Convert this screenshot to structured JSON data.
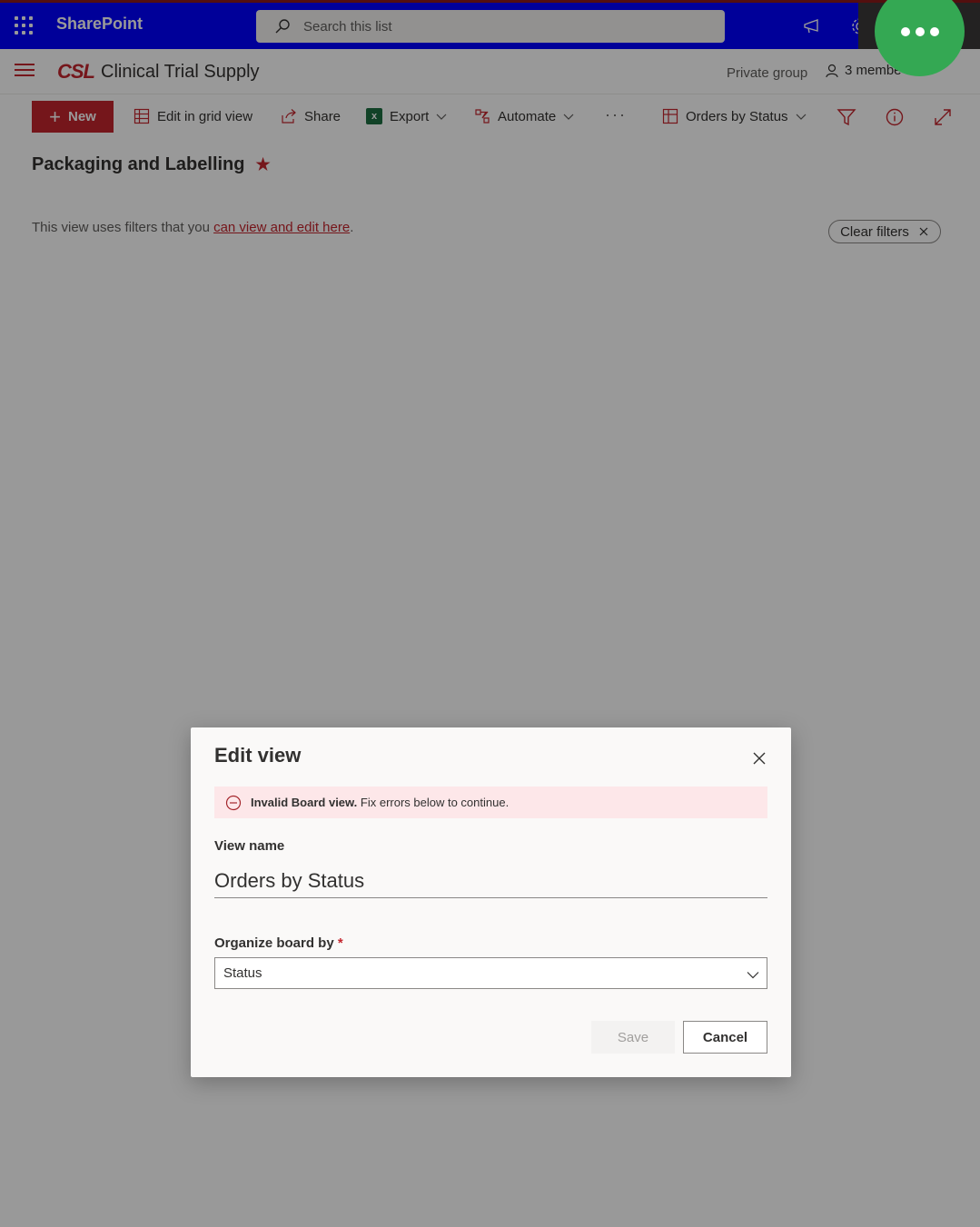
{
  "suite": {
    "title": "SharePoint",
    "search_placeholder": "Search this list"
  },
  "site": {
    "logo": "CSL",
    "title": "Clinical Trial Supply",
    "privacy": "Private group",
    "members": "3 membe"
  },
  "commands": {
    "new": "New",
    "edit_grid": "Edit in grid view",
    "share": "Share",
    "export": "Export",
    "automate": "Automate",
    "more": "···",
    "view_selector": "Orders by Status"
  },
  "page": {
    "title": "Packaging and Labelling",
    "filter_prefix": "This view uses filters that you ",
    "filter_link": "can view and edit here",
    "filter_suffix": ".",
    "clear_filters": "Clear filters"
  },
  "dialog": {
    "title": "Edit view",
    "error_bold": "Invalid Board view.",
    "error_text": " Fix errors below to continue.",
    "view_name_label": "View name",
    "view_name_value": "Orders by Status",
    "organize_label": "Organize board by",
    "required_mark": "*",
    "organize_value": "Status",
    "save": "Save",
    "cancel": "Cancel"
  },
  "colors": {
    "suitebar": "#0000ff",
    "brand": "#c4262e",
    "fab": "#34a853"
  }
}
